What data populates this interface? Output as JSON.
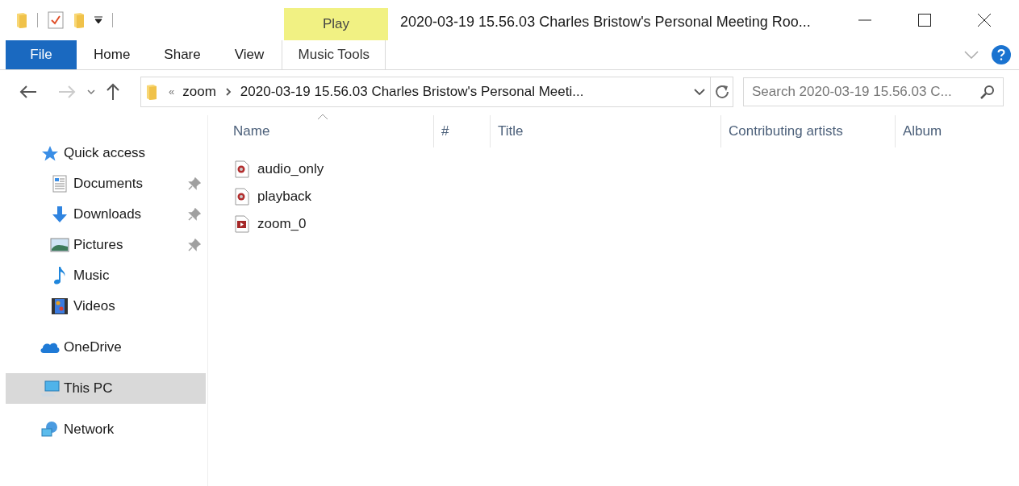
{
  "window": {
    "title": "2020-03-19 15.56.03 Charles Bristow's Personal Meeting Roo..."
  },
  "contextual_tab": {
    "header": "Play",
    "label": "Music Tools"
  },
  "ribbon_tabs": [
    {
      "label": "File",
      "kind": "file"
    },
    {
      "label": "Home",
      "kind": "tab"
    },
    {
      "label": "Share",
      "kind": "tab"
    },
    {
      "label": "View",
      "kind": "tab"
    }
  ],
  "address_bar": {
    "overflow": "«",
    "segments": [
      "zoom",
      "2020-03-19 15.56.03 Charles Bristow's Personal Meeti..."
    ]
  },
  "search": {
    "placeholder": "Search 2020-03-19 15.56.03 C..."
  },
  "sidebar": {
    "items": [
      {
        "label": "Quick access",
        "selected": false,
        "children": [
          {
            "label": "Documents",
            "pinned": true,
            "selected": false
          },
          {
            "label": "Downloads",
            "pinned": true,
            "selected": false
          },
          {
            "label": "Pictures",
            "pinned": true,
            "selected": false
          },
          {
            "label": "Music",
            "pinned": false,
            "selected": false
          },
          {
            "label": "Videos",
            "pinned": false,
            "selected": false
          }
        ]
      },
      {
        "label": "OneDrive",
        "selected": false
      },
      {
        "label": "This PC",
        "selected": true
      },
      {
        "label": "Network",
        "selected": false
      }
    ]
  },
  "table": {
    "columns": [
      {
        "label": "Name",
        "sorted": true
      },
      {
        "label": "#",
        "sorted": false
      },
      {
        "label": "Title",
        "sorted": false
      },
      {
        "label": "Contributing artists",
        "sorted": false
      },
      {
        "label": "Album",
        "sorted": false
      }
    ],
    "rows": [
      {
        "name": "audio_only",
        "kind": "audio"
      },
      {
        "name": "playback",
        "kind": "audio"
      },
      {
        "name": "zoom_0",
        "kind": "video"
      }
    ]
  }
}
